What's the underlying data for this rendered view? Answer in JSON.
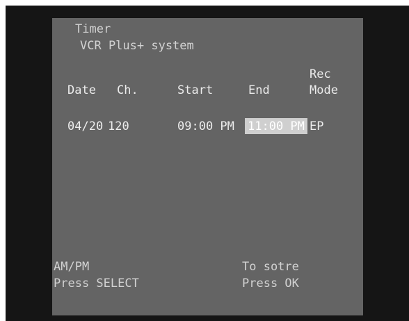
{
  "header": {
    "title": "Timer",
    "subtitle": "VCR Plus+ system"
  },
  "table": {
    "columns": {
      "date": "Date",
      "channel": "Ch.",
      "start": "Start",
      "end": "End",
      "rec_mode_line1": "Rec",
      "rec_mode_line2": "Mode"
    },
    "rows": [
      {
        "date": "04/20",
        "channel": "120",
        "start": "09:00 PM",
        "end": "11:00 PM",
        "rec_mode": "EP"
      }
    ]
  },
  "footer": {
    "left_line1": "AM/PM",
    "left_line2": "Press SELECT",
    "right_line1": "To sotre",
    "right_line2": "Press OK"
  },
  "colors": {
    "screen_background": "#151515",
    "panel_background": "#646464",
    "text": "#ececec",
    "highlight": "#cfcfcf"
  }
}
